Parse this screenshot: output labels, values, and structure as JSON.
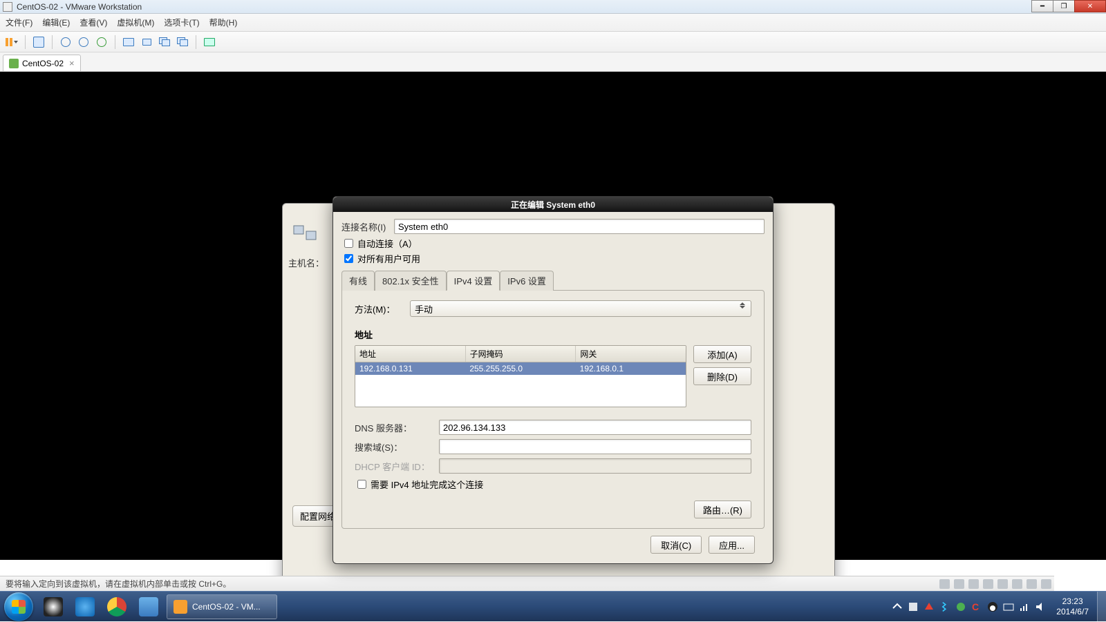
{
  "window": {
    "title": "CentOS-02 - VMware Workstation",
    "tab_name": "CentOS-02"
  },
  "menu": {
    "file": "文件(F)",
    "edit": "编辑(E)",
    "view": "查看(V)",
    "vm": "虚拟机(M)",
    "tabs": "选项卡(T)",
    "help": "帮助(H)"
  },
  "centos_bg": {
    "hostname_label": "主机名：",
    "config_net": "配置网络"
  },
  "dialog": {
    "title": "正在编辑 System eth0",
    "conn_name_label": "连接名称(I)",
    "conn_name_value": "System eth0",
    "auto_connect": "自动连接（A）",
    "all_users": "对所有用户可用",
    "tabs": {
      "wired": "有线",
      "sec": "802.1x 安全性",
      "ipv4": "IPv4 设置",
      "ipv6": "IPv6 设置"
    },
    "method_label": "方法(M)：",
    "method_value": "手动",
    "addr_section": "地址",
    "addr_headers": {
      "addr": "地址",
      "mask": "子网掩码",
      "gw": "网关"
    },
    "addr_row": {
      "addr": "192.168.0.131",
      "mask": "255.255.255.0",
      "gw": "192.168.0.1"
    },
    "btn_add": "添加(A)",
    "btn_del": "删除(D)",
    "dns_label": "DNS 服务器：",
    "dns_value": "202.96.134.133",
    "search_label": "搜索域(S)：",
    "dhcp_label": "DHCP 客户端 ID：",
    "require_ipv4": "需要 IPv4 地址完成这个连接",
    "routes": "路由…(R)",
    "cancel": "取消(C)",
    "apply": "应用..."
  },
  "statusbar": {
    "hint": "要将输入定向到该虚拟机，请在虚拟机内部单击或按 Ctrl+G。"
  },
  "taskbar": {
    "active": "CentOS-02 - VM...",
    "time": "23:23",
    "date": "2014/6/7"
  }
}
